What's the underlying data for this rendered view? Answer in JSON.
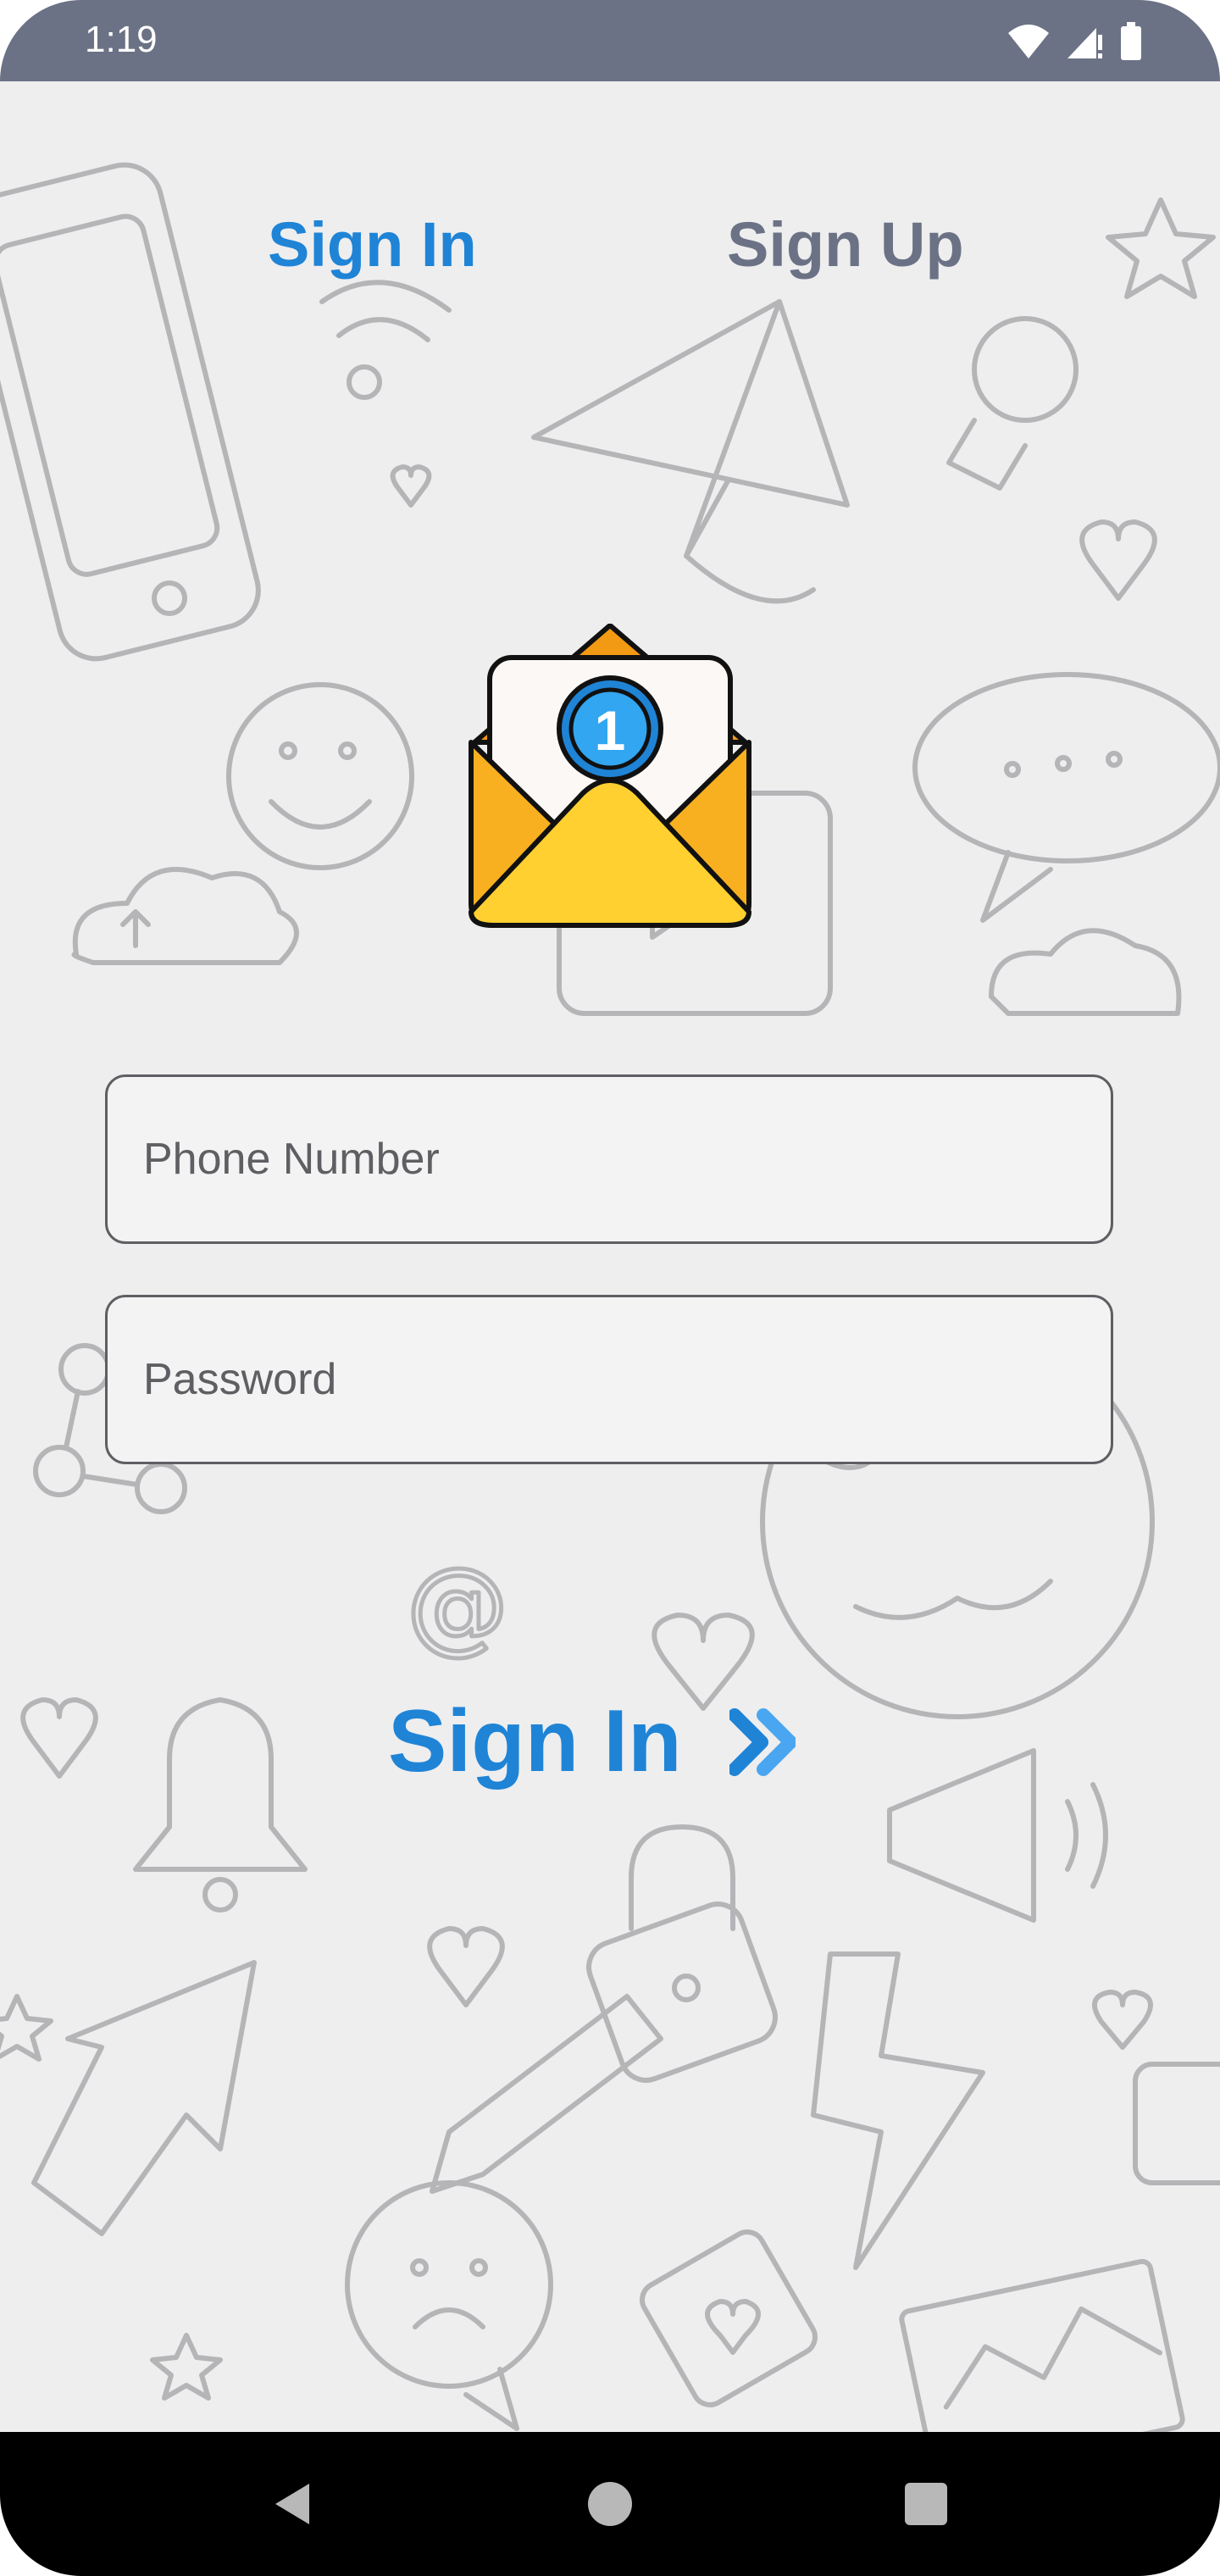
{
  "status_bar": {
    "time": "1:19",
    "icons": [
      "wifi-icon",
      "cell-signal-icon",
      "battery-icon"
    ]
  },
  "tabs": [
    {
      "label": "Sign In",
      "active": true
    },
    {
      "label": "Sign Up",
      "active": false
    }
  ],
  "hero": {
    "icon": "envelope-notification-icon",
    "badge": "1"
  },
  "form": {
    "phone_placeholder": "Phone Number",
    "password_placeholder": "Password"
  },
  "action": {
    "label": "Sign In",
    "icon": "double-chevron-right-icon"
  },
  "nav_bar": {
    "buttons": [
      "back-icon",
      "home-icon",
      "recents-icon"
    ]
  },
  "colors": {
    "accent": "#1f84d6",
    "inactive_tab": "#6c7285",
    "status_bar": "#6c7285",
    "background": "#eeeeef",
    "nav_bar": "#000000"
  }
}
